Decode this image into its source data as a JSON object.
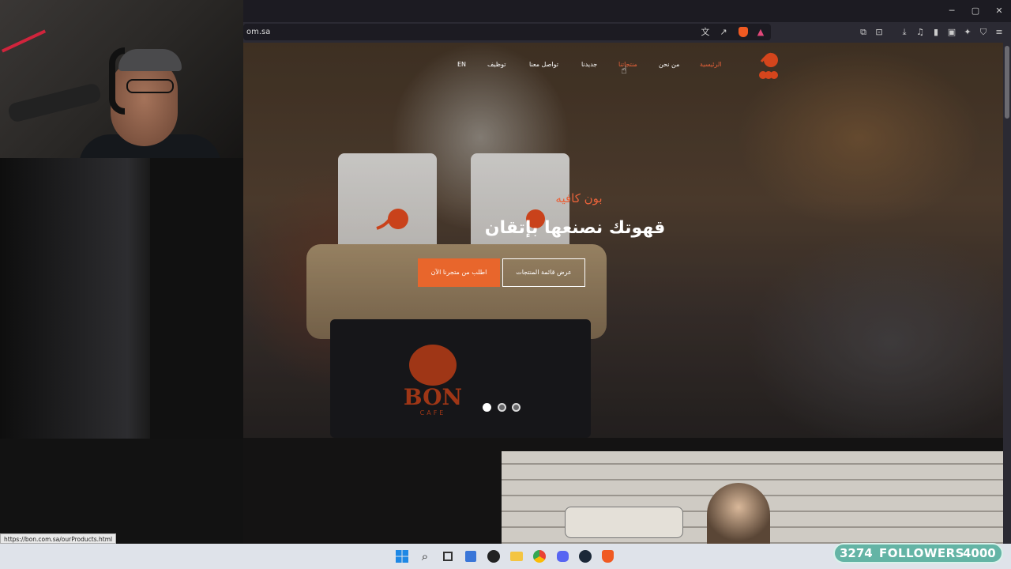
{
  "browser": {
    "url_fragment": "om.sa",
    "status_url": "https://bon.com.sa/ourProducts.html",
    "window_controls": [
      "minimize-icon",
      "restore-icon",
      "close-icon"
    ]
  },
  "site": {
    "nav": {
      "items": [
        "الرئيسية",
        "من نحن",
        "منتجاتنا",
        "جديدنا",
        "تواصل معنا",
        "توظيف",
        "EN"
      ],
      "active_index": 0,
      "hover_index": 2
    },
    "hero": {
      "brand": "بون كافيه",
      "title": "قهوتك نصنعها بإتقان",
      "btn_order": "اطلب من متجرنا الآن",
      "btn_menu": "عرض قائمة المنتجات",
      "slides": 3,
      "active_slide": 0,
      "apron_brand": "BON",
      "apron_sub": "CAFE"
    },
    "colors": {
      "accent": "#e8623a",
      "button": "#e8662c"
    }
  },
  "stream": {
    "followers_count": "3274",
    "followers_label": "FOLLOWERS",
    "followers_goal": "4000"
  },
  "taskbar": {
    "icons": [
      "windows-start-icon",
      "search-icon",
      "task-view-icon",
      "store-icon",
      "obs-icon",
      "file-explorer-icon",
      "chrome-icon",
      "discord-icon",
      "steam-icon",
      "brave-icon"
    ]
  }
}
